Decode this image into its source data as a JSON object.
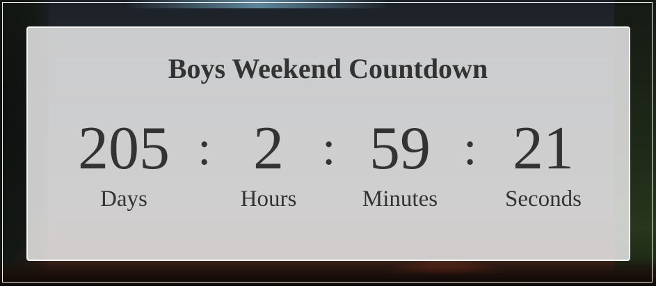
{
  "countdown": {
    "title": "Boys Weekend Countdown",
    "separator": ":",
    "units": [
      {
        "value": "205",
        "label": "Days"
      },
      {
        "value": "2",
        "label": "Hours"
      },
      {
        "value": "59",
        "label": "Minutes"
      },
      {
        "value": "21",
        "label": "Seconds"
      }
    ]
  }
}
